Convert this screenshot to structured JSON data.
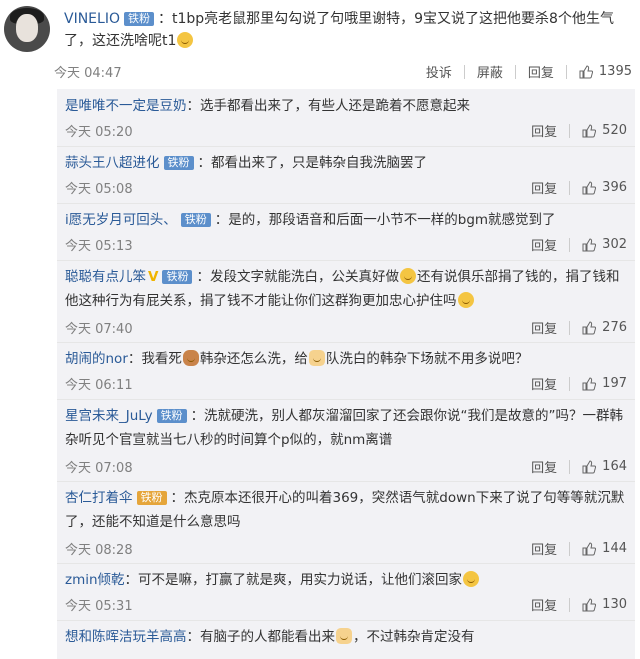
{
  "top": {
    "username": "VINELIO",
    "badge": "铁粉",
    "text": "：t1bp亮老鼠那里勾勾说了句哦里谢特，9宝又说了这把他要杀8个他生气了，这还洗啥呢t1",
    "time": "今天 04:47",
    "report": "投诉",
    "block": "屏蔽",
    "reply": "回复",
    "likes": "1395"
  },
  "replies": [
    {
      "name": "是唯唯不一定是豆奶",
      "badge": "",
      "text": "：选手都看出来了，有些人还是跪着不愿意起来",
      "time": "今天 05:20",
      "reply": "回复",
      "likes": "520"
    },
    {
      "name": "蒜头王八超进化",
      "badge": "铁粉",
      "text": "：都看出来了，只是韩杂自我洗脑罢了",
      "time": "今天 05:08",
      "reply": "回复",
      "likes": "396"
    },
    {
      "name": "i愿无岁月可回头、",
      "badge": "铁粉",
      "text": "：是的，那段语音和后面一小节不一样的bgm就感觉到了",
      "time": "今天 05:13",
      "reply": "回复",
      "likes": "302"
    },
    {
      "name": "聪聪有点儿笨",
      "badge": "铁粉",
      "text1": "：发段文字就能洗白，公关真好做",
      "text2": "还有说俱乐部捐了钱的，捐了钱和他这种行为有屁关系，捐了钱不才能让你们这群狗更加忠心护住吗",
      "time": "今天 07:40",
      "reply": "回复",
      "likes": "276"
    },
    {
      "name": "胡闹的nor",
      "badge": "",
      "text1": "：我看死",
      "text2": "韩杂还怎么洗，给",
      "text3": "队洗白的韩杂下场就不用多说吧？",
      "time": "今天 06:11",
      "reply": "回复",
      "likes": "197"
    },
    {
      "name": "星宫未来_JuLy",
      "badge": "铁粉",
      "text": "：洗就硬洗，别人都灰溜溜回家了还会跟你说“我们是故意的”吗？一群韩杂听见个官宣就当七八秒的时间算个p似的，就nm离谱",
      "time": "今天 07:08",
      "reply": "回复",
      "likes": "164"
    },
    {
      "name": "杏仁打着伞",
      "badge": "铁粉",
      "text": "：杰克原本还很开心的叫着369，突然语气就down下来了说了句等等就沉默了，还能不知道是什么意思吗",
      "time": "今天 08:28",
      "reply": "回复",
      "likes": "144"
    },
    {
      "name": "zmin倾乾",
      "badge": "",
      "text": "：可不是嘛，打赢了就是爽，用实力说话，让他们滚回家",
      "time": "今天 05:31",
      "reply": "回复",
      "likes": "130"
    },
    {
      "name": "想和陈晖洁玩羊高高",
      "badge": "",
      "text1": "：有脑子的人都能看出来",
      "text2": "，不过韩杂肯定没有",
      "time": "",
      "reply": "",
      "likes": ""
    }
  ]
}
